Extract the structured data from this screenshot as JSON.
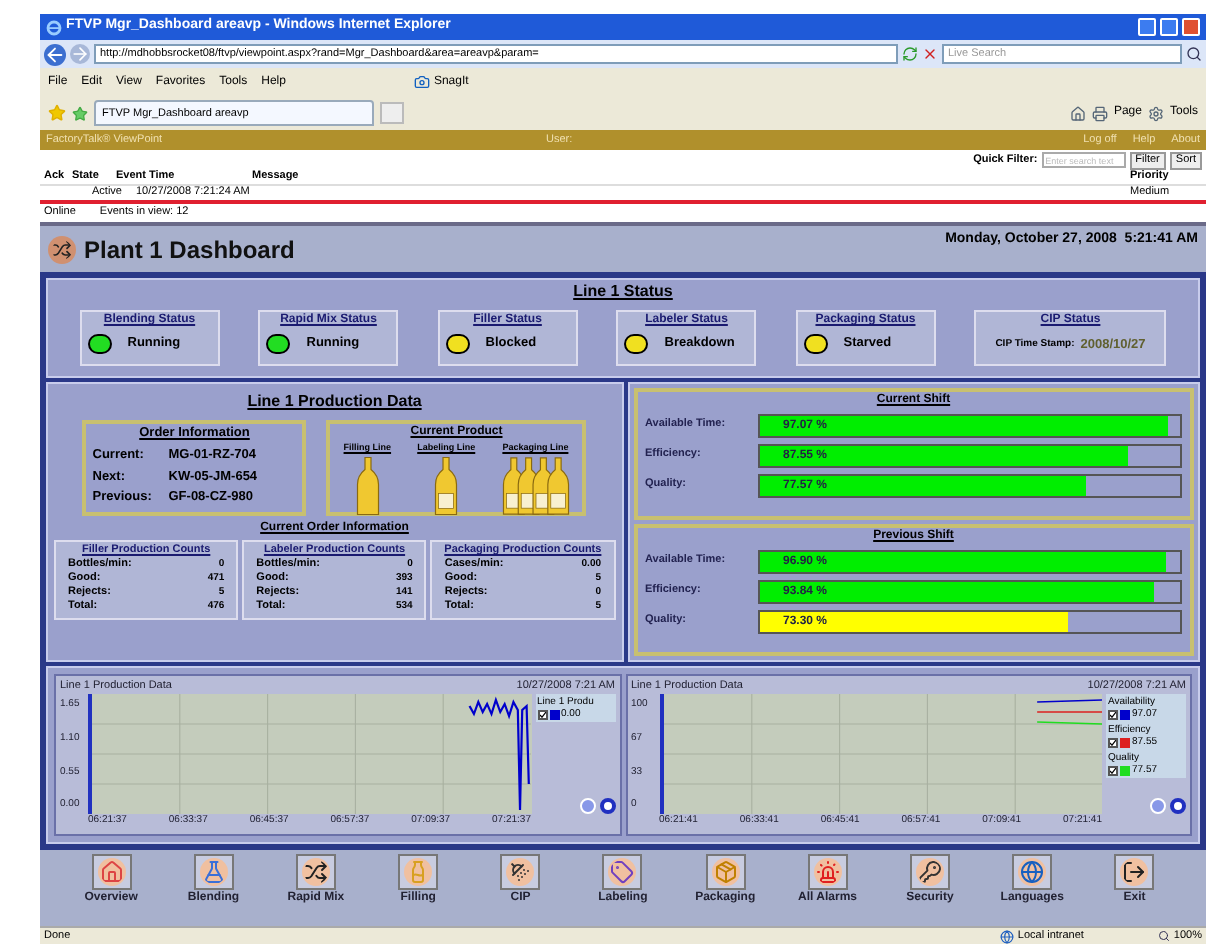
{
  "browser": {
    "title": "FTVP Mgr_Dashboard areavp - Windows Internet Explorer",
    "address": "http://mdhobbsrocket08/ftvp/viewpoint.aspx?rand=Mgr_Dashboard&area=areavp&param=",
    "search_placeholder": "Live Search",
    "menu": [
      "File",
      "Edit",
      "View",
      "Favorites",
      "Tools",
      "Help"
    ],
    "snagit": "SnagIt",
    "tab": "FTVP Mgr_Dashboard areavp",
    "commands": [
      "Page",
      "Tools"
    ]
  },
  "portal": {
    "brand": "FactoryTalk® ViewPoint",
    "user_label": "User:",
    "links": [
      "Log off",
      "Help",
      "About"
    ],
    "quick_filter_label": "Quick Filter:",
    "quick_filter_placeholder": "Enter search text",
    "buttons": [
      "Filter",
      "Sort"
    ]
  },
  "alarms": {
    "columns": [
      "Ack",
      "State",
      "Event Time",
      "Message",
      "Priority"
    ],
    "rows": [
      {
        "state": "Active",
        "time": "10/27/2008 7:21:24 AM",
        "priority": "Medium"
      }
    ],
    "status": "Online",
    "events": "Events in view: 12"
  },
  "dashboard": {
    "title": "Plant 1 Dashboard",
    "datetime": "Monday, October 27, 2008  5:21:41 AM"
  },
  "line_status": {
    "title": "Line 1 Status",
    "items": [
      {
        "kind": "lamp",
        "label": "Blending Status",
        "value": "Running",
        "color": "#22dd22"
      },
      {
        "kind": "lamp",
        "label": "Rapid Mix Status",
        "value": "Running",
        "color": "#22dd22"
      },
      {
        "kind": "lamp",
        "label": "Filler Status",
        "value": "Blocked",
        "color": "#f0e020"
      },
      {
        "kind": "lamp",
        "label": "Labeler Status",
        "value": "Breakdown",
        "color": "#f0e020"
      },
      {
        "kind": "lamp",
        "label": "Packaging Status",
        "value": "Starved",
        "color": "#f0e020"
      },
      {
        "kind": "stamp",
        "label": "CIP Status",
        "stamp_label": "CIP Time Stamp:",
        "value": "2008/10/27"
      }
    ]
  },
  "production": {
    "title": "Line 1 Production Data",
    "order": {
      "title": "Order Information",
      "rows": [
        {
          "label": "Current:",
          "value": "MG-01-RZ-704"
        },
        {
          "label": "Next:",
          "value": "KW-05-JM-654"
        },
        {
          "label": "Previous:",
          "value": "GF-08-CZ-980"
        }
      ]
    },
    "product": {
      "title": "Current Product",
      "lines": [
        {
          "label": "Filling Line",
          "kind": "bottle"
        },
        {
          "label": "Labeling Line",
          "kind": "labeled"
        },
        {
          "label": "Packaging Line",
          "kind": "pack"
        }
      ]
    },
    "current_order_title": "Current Order Information",
    "counts": [
      {
        "title": "Filler Production Counts",
        "rows": [
          {
            "label": "Bottles/min:",
            "value": "0"
          },
          {
            "label": "Good:",
            "value": "471"
          },
          {
            "label": "Rejects:",
            "value": "5"
          },
          {
            "label": "Total:",
            "value": "476"
          }
        ]
      },
      {
        "title": "Labeler Production Counts",
        "rows": [
          {
            "label": "Bottles/min:",
            "value": "0"
          },
          {
            "label": "Good:",
            "value": "393"
          },
          {
            "label": "Rejects:",
            "value": "141"
          },
          {
            "label": "Total:",
            "value": "534"
          }
        ]
      },
      {
        "title": "Packaging Production Counts",
        "rows": [
          {
            "label": "Cases/min:",
            "value": "0.00"
          },
          {
            "label": "Good:",
            "value": "5"
          },
          {
            "label": "Rejects:",
            "value": "0"
          },
          {
            "label": "Total:",
            "value": "5"
          }
        ]
      }
    ]
  },
  "shifts": [
    {
      "title": "Current Shift",
      "metrics": [
        {
          "label": "Available Time:",
          "reading": "97.07 %",
          "level": 0.9707,
          "color": "#00ee00"
        },
        {
          "label": "Efficiency:",
          "reading": "87.55 %",
          "level": 0.8755,
          "color": "#00ee00"
        },
        {
          "label": "Quality:",
          "reading": "77.57 %",
          "level": 0.7757,
          "color": "#00ee00"
        }
      ]
    },
    {
      "title": "Previous Shift",
      "metrics": [
        {
          "label": "Available Time:",
          "reading": "96.90 %",
          "level": 0.969,
          "color": "#00ee00"
        },
        {
          "label": "Efficiency:",
          "reading": "93.84 %",
          "level": 0.9384,
          "color": "#00ee00"
        },
        {
          "label": "Quality:",
          "reading": "73.30 %",
          "level": 0.733,
          "color": "#ffff00"
        }
      ]
    }
  ],
  "trends": [
    {
      "kind": "noise",
      "title": "Line 1 Production Data",
      "timestamp": "10/27/2008 7:21 AM",
      "yticks": [
        "1.65",
        "1.10",
        "0.55",
        "0.00"
      ],
      "xticks": [
        "06:21:37",
        "06:33:37",
        "06:45:37",
        "06:57:37",
        "07:09:37",
        "07:21:37"
      ],
      "legend": [
        {
          "name": "Line 1 Produ",
          "value": "0.00",
          "color": "#0000cc",
          "checked": true
        }
      ]
    },
    {
      "kind": "lines",
      "title": "Line 1 Production Data",
      "timestamp": "10/27/2008 7:21 AM",
      "yticks": [
        "100",
        "67",
        "33",
        "0"
      ],
      "xticks": [
        "06:21:41",
        "06:33:41",
        "06:45:41",
        "06:57:41",
        "07:09:41",
        "07:21:41"
      ],
      "legend": [
        {
          "name": "Availability",
          "value": "97.07",
          "color": "#0000cc",
          "checked": true
        },
        {
          "name": "Efficiency",
          "value": "87.55",
          "color": "#dd2020",
          "checked": true
        },
        {
          "name": "Quality",
          "value": "77.57",
          "color": "#20dd20",
          "checked": true
        }
      ]
    }
  ],
  "nav": [
    "Overview",
    "Blending",
    "Rapid Mix",
    "Filling",
    "CIP",
    "Labeling",
    "Packaging",
    "All Alarms",
    "Security",
    "Languages",
    "Exit"
  ],
  "status_bar": {
    "left": "Done",
    "zone": "Local intranet",
    "zoom": "100%"
  }
}
